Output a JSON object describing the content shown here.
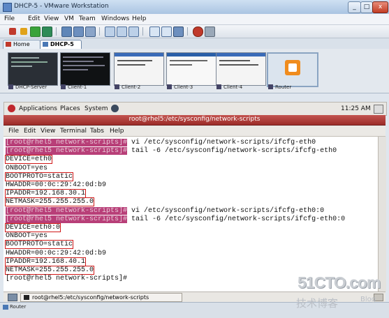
{
  "window": {
    "title": "DHCP-5 - VMware Workstation"
  },
  "menubar": [
    "File",
    "Edit",
    "View",
    "VM",
    "Team",
    "Windows",
    "Help"
  ],
  "tabs": [
    {
      "label": "Home"
    },
    {
      "label": "DHCP-5"
    }
  ],
  "thumbnails": [
    {
      "label": "DHCP-Server"
    },
    {
      "label": "Client-1"
    },
    {
      "label": "Client-2"
    },
    {
      "label": "Client-3"
    },
    {
      "label": "Client-4"
    },
    {
      "label": "Router"
    }
  ],
  "guest_panel": {
    "applications": "Applications",
    "places": "Places",
    "system": "System",
    "clock": "11:25 AM"
  },
  "terminal": {
    "title": "root@rhel5:/etc/sysconfig/network-scripts",
    "menu": [
      "File",
      "Edit",
      "View",
      "Terminal",
      "Tabs",
      "Help"
    ],
    "lines": [
      {
        "prompt": "[root@rhel5 network-scripts]#",
        "cmd": " vi /etc/sysconfig/network-scripts/ifcfg-eth0"
      },
      {
        "prompt": "[root@rhel5 network-scripts]#",
        "cmd": " tail -6 /etc/sysconfig/network-scripts/ifcfg-eth0"
      },
      {
        "text": "DEVICE=eth0",
        "boxed": true
      },
      {
        "text": "ONBOOT=yes"
      },
      {
        "text": "BOOTPROTO=static",
        "boxed": true
      },
      {
        "text": "HWADDR=00:0c:29:42:0d:b9"
      },
      {
        "text": "IPADDR=192.168.30.1",
        "boxed": true
      },
      {
        "text": "NETMASK=255.255.255.0",
        "boxed": true
      },
      {
        "prompt": "[root@rhel5 network-scripts]#",
        "cmd": " vi /etc/sysconfig/network-scripts/ifcfg-eth0:0"
      },
      {
        "prompt": "[root@rhel5 network-scripts]#",
        "cmd": " tail -6 /etc/sysconfig/network-scripts/ifcfg-eth0:0"
      },
      {
        "text": "DEVICE=eth0:0",
        "boxed": true
      },
      {
        "text": "ONBOOT=yes"
      },
      {
        "text": "BOOTPROTO=static",
        "boxed": true
      },
      {
        "text": "HWADDR=00:0c:29:42:0d:b9"
      },
      {
        "text": "IPADDR=192.168.40.1",
        "boxed": true
      },
      {
        "text": "NETMASK=255.255.255.0",
        "boxed": true
      },
      {
        "text": "[root@rhel5 network-scripts]#"
      }
    ]
  },
  "taskbar": {
    "task": "root@rhel5:/etc/sysconfig/network-scripts"
  },
  "statusbar": {
    "text": "Router"
  },
  "watermark": {
    "main": "51CTO.com",
    "sub": "技术博客",
    "blog": "Blog"
  },
  "colors": {
    "prompt_highlight": "#b83f78",
    "annotation_box": "#d01818",
    "terminal_title": "#b0403c"
  },
  "icons": [
    "app-icon",
    "minimize-icon",
    "maximize-icon",
    "close-icon",
    "stop-icon",
    "pause-icon",
    "play-icon",
    "reset-icon",
    "snapshot-icon",
    "revert-icon",
    "manager-icon",
    "fullscreen-icon",
    "quickswitch-icon",
    "console-icon",
    "prefs-icon",
    "home-icon",
    "vm-tab-icon",
    "redhat-icon",
    "network-icon",
    "terminal-icon"
  ]
}
